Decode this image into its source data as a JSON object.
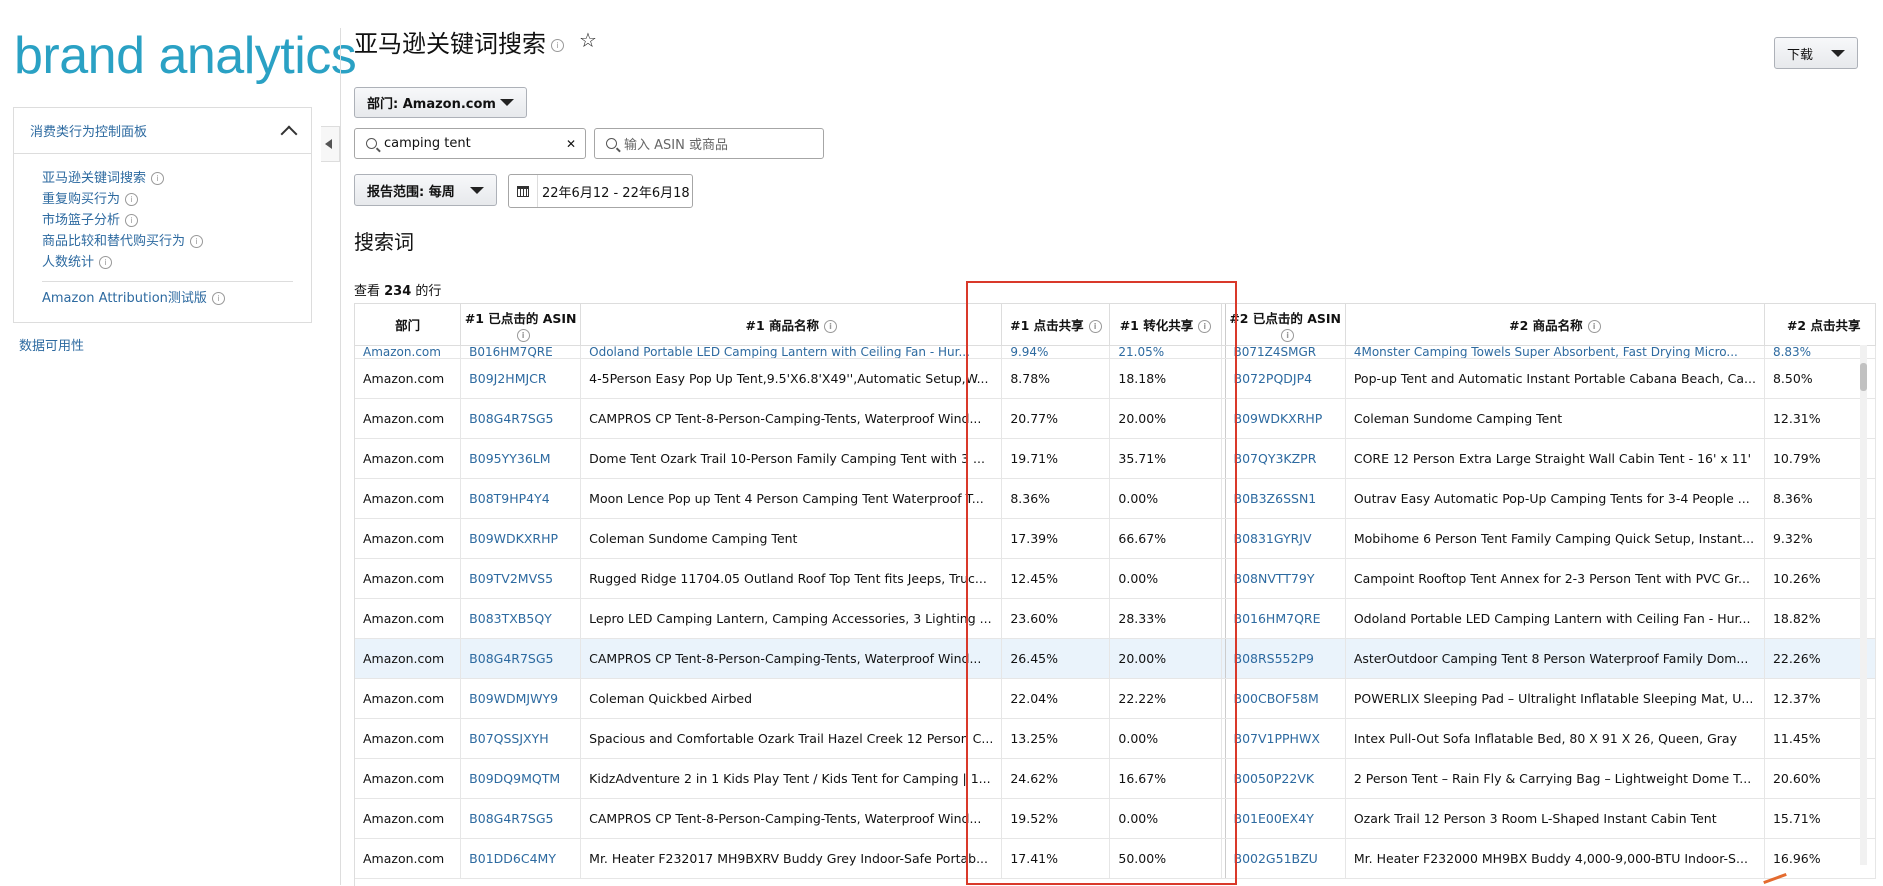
{
  "logo": "brand analytics",
  "sidebar": {
    "header": "消费类行为控制面板",
    "items": [
      {
        "label": "亚马逊关键词搜索"
      },
      {
        "label": "重复购买行为"
      },
      {
        "label": "市场篮子分析"
      },
      {
        "label": "商品比较和替代购买行为"
      },
      {
        "label": "人数统计"
      }
    ],
    "extra": "Amazon Attribution测试版",
    "availability": "数据可用性"
  },
  "page": {
    "title": "亚马逊关键词搜索",
    "download": "下载",
    "department": "部门: Amazon.com",
    "search_value": "camping tent",
    "asin_placeholder": "输入 ASIN 或商品",
    "range": "报告范围: 每周",
    "date": "22年6月12 - 22年6月18",
    "section": "搜索词",
    "rows_prefix": "查看 ",
    "rows_count": "234",
    "rows_suffix": " 的行"
  },
  "table": {
    "headers": [
      "部门",
      "#1 已点击的 ASIN",
      "#1 商品名称",
      "#1 点击共享",
      "#1 转化共享",
      "#2 已点击的 ASIN",
      "#2 商品名称",
      "#2 点击共享"
    ],
    "partial_row": [
      "Amazon.com",
      "B016HM7QRE",
      "Odoland Portable LED Camping Lantern with Ceiling Fan - Hur...",
      "9.94%",
      "21.05%",
      "B071Z4SMGR",
      "4Monster Camping Towels Super Absorbent, Fast Drying Micro...",
      "8.83%"
    ],
    "rows": [
      [
        "Amazon.com",
        "B09J2HMJCR",
        "4-5Person Easy Pop Up Tent,9.5'X6.8'X49'',Automatic Setup,W...",
        "8.78%",
        "18.18%",
        "B072PQDJP4",
        "Pop-up Tent and Automatic Instant Portable Cabana Beach, Ca...",
        "8.50%"
      ],
      [
        "Amazon.com",
        "B08G4R7SG5",
        "CAMPROS CP Tent-8-Person-Camping-Tents, Waterproof Wind...",
        "20.77%",
        "20.00%",
        "B09WDKXRHP",
        "Coleman Sundome Camping Tent",
        "12.31%"
      ],
      [
        "Amazon.com",
        "B095YY36LM",
        "Dome Tent Ozark Trail 10-Person Family Camping Tent with 3 ...",
        "19.71%",
        "35.71%",
        "B07QY3KZPR",
        "CORE 12 Person Extra Large Straight Wall Cabin Tent - 16' x 11'",
        "10.79%"
      ],
      [
        "Amazon.com",
        "B08T9HP4Y4",
        "Moon Lence Pop up Tent 4 Person Camping Tent Waterproof T...",
        "8.36%",
        "0.00%",
        "B0B3Z6SSN1",
        "Outrav Easy Automatic Pop-Up Camping Tents for 3-4 People ...",
        "8.36%"
      ],
      [
        "Amazon.com",
        "B09WDKXRHP",
        "Coleman Sundome Camping Tent",
        "17.39%",
        "66.67%",
        "B0831GYRJV",
        "Mobihome 6 Person Tent Family Camping Quick Setup, Instant...",
        "9.32%"
      ],
      [
        "Amazon.com",
        "B09TV2MVS5",
        "Rugged Ridge 11704.05 Outland Roof Top Tent fits Jeeps, Truc...",
        "12.45%",
        "0.00%",
        "B08NVTT79Y",
        "Campoint Rooftop Tent Annex for 2-3 Person Tent with PVC Gr...",
        "10.26%"
      ],
      [
        "Amazon.com",
        "B083TXB5QY",
        "Lepro LED Camping Lantern, Camping Accessories, 3 Lighting ...",
        "23.60%",
        "28.33%",
        "B016HM7QRE",
        "Odoland Portable LED Camping Lantern with Ceiling Fan - Hur...",
        "18.82%"
      ],
      [
        "Amazon.com",
        "B08G4R7SG5",
        "CAMPROS CP Tent-8-Person-Camping-Tents, Waterproof Wind...",
        "26.45%",
        "20.00%",
        "B08RS552P9",
        "AsterOutdoor Camping Tent 8 Person Waterproof Family Dom...",
        "22.26%"
      ],
      [
        "Amazon.com",
        "B09WDMJWY9",
        "Coleman Quickbed Airbed",
        "22.04%",
        "22.22%",
        "B00CBOF58M",
        "POWERLIX Sleeping Pad – Ultralight Inflatable Sleeping Mat, U...",
        "12.37%"
      ],
      [
        "Amazon.com",
        "B07QSSJXYH",
        "Spacious and Comfortable Ozark Trail Hazel Creek 12 Person C...",
        "13.25%",
        "0.00%",
        "B07V1PPHWX",
        "Intex Pull-Out Sofa Inflatable Bed, 80 X 91 X 26, Queen, Gray",
        "11.45%"
      ],
      [
        "Amazon.com",
        "B09DQ9MQTM",
        "KidzAdventure 2 in 1 Kids Play Tent / Kids Tent for Camping | 1...",
        "24.62%",
        "16.67%",
        "B0050P22VK",
        "2 Person Tent – Rain Fly & Carrying Bag – Lightweight Dome T...",
        "20.60%"
      ],
      [
        "Amazon.com",
        "B08G4R7SG5",
        "CAMPROS CP Tent-8-Person-Camping-Tents, Waterproof Wind...",
        "19.52%",
        "0.00%",
        "B01E00EX4Y",
        "Ozark Trail 12 Person 3 Room L-Shaped Instant Cabin Tent",
        "15.71%"
      ],
      [
        "Amazon.com",
        "B01DD6C4MY",
        "Mr. Heater F232017 MH9BXRV Buddy Grey Indoor-Safe Portab...",
        "17.41%",
        "50.00%",
        "B002G51BZU",
        "Mr. Heater F232000 MH9BX Buddy 4,000-9,000-BTU Indoor-S...",
        "16.96%"
      ]
    ],
    "highlighted_row": 7
  }
}
